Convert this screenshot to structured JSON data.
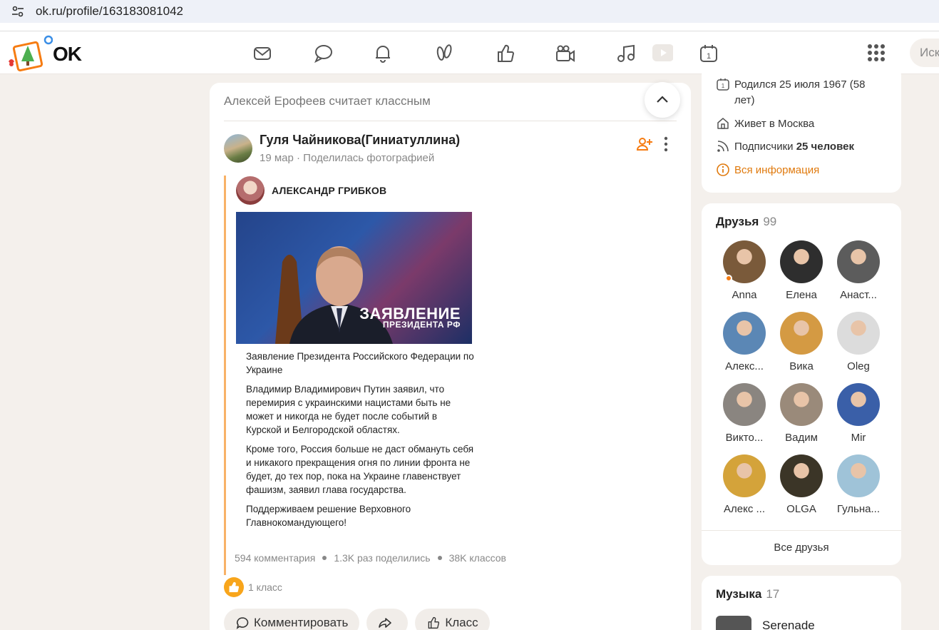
{
  "browser": {
    "url": "ok.ru/profile/163183081042"
  },
  "header": {
    "logo_text": "OK",
    "search_placeholder": "Иск",
    "nav_icons": [
      "mail-icon",
      "chat-icon",
      "bell-icon",
      "guests-icon",
      "like-icon",
      "video-icon",
      "music-icon",
      "play-icon",
      "calendar-icon"
    ]
  },
  "feed": {
    "liker_text": "Алексей Ерофеев считает классным",
    "author_name": "Гуля Чайникова(Гиниатуллина)",
    "author_meta": "19 мар · Поделилась фотографией",
    "repost_author": "АЛЕКСАНДР ГРИБКОВ",
    "image_caption_main": "ЗАЯВЛЕНИЕ",
    "image_caption_sub": "ПРЕЗИДЕНТА РФ",
    "paragraphs": [
      "Заявление Президента Российского Федерации по Украине",
      "Владимир Владимирович Путин заявил, что перемирия с украинскими нацистами быть не может и никогда не будет после событий в Курской и Белгородской областях.",
      "Кроме того, Россия больше не даст обмануть себя и никакого прекращения огня по линии фронта не будет, до тех пор, пока на Украине главенствует фашизм, заявил глава государства.",
      "Поддерживаем решение Верховного Главнокомандующего!"
    ],
    "stats": {
      "comments": "594 комментария",
      "shares": "1.3K раз поделились",
      "classes": "38K классов"
    },
    "likes_count": "1 класс",
    "actions": {
      "comment": "Комментировать",
      "klass": "Класс"
    }
  },
  "profile_info": {
    "born": "Родился 25 июля 1967 (58 лет)",
    "lives": "Живет в Москва",
    "subscribers_label": "Подписчики",
    "subscribers_value": "25 человек",
    "all_info": "Вся информация"
  },
  "friends": {
    "title": "Друзья",
    "count": "99",
    "all_label": "Все друзья",
    "items": [
      {
        "name": "Anna",
        "color": "#7a5a3a",
        "online": true
      },
      {
        "name": "Елена",
        "color": "#2e2e2e",
        "online": false
      },
      {
        "name": "Анаст...",
        "color": "#5c5c5c",
        "online": false
      },
      {
        "name": "Алекс...",
        "color": "#5b87b5",
        "online": false
      },
      {
        "name": "Вика",
        "color": "#d49a43",
        "online": false
      },
      {
        "name": "Oleg",
        "color": "#dcdcdc",
        "online": false
      },
      {
        "name": "Викто...",
        "color": "#8a8580",
        "online": false
      },
      {
        "name": "Вадим",
        "color": "#9a8a7a",
        "online": false
      },
      {
        "name": "Mir",
        "color": "#3a5fa8",
        "online": false
      },
      {
        "name": "Алекс ...",
        "color": "#d4a33a",
        "online": false
      },
      {
        "name": "OLGA",
        "color": "#3b3527",
        "online": false
      },
      {
        "name": "Гульна...",
        "color": "#9fc3d8",
        "online": false
      }
    ]
  },
  "music": {
    "title": "Музыка",
    "count": "17",
    "song": "Serenade"
  },
  "colors": {
    "accent": "#f67c12",
    "page_bg": "#f4f0ec",
    "repost_bar": "#f8b267"
  }
}
